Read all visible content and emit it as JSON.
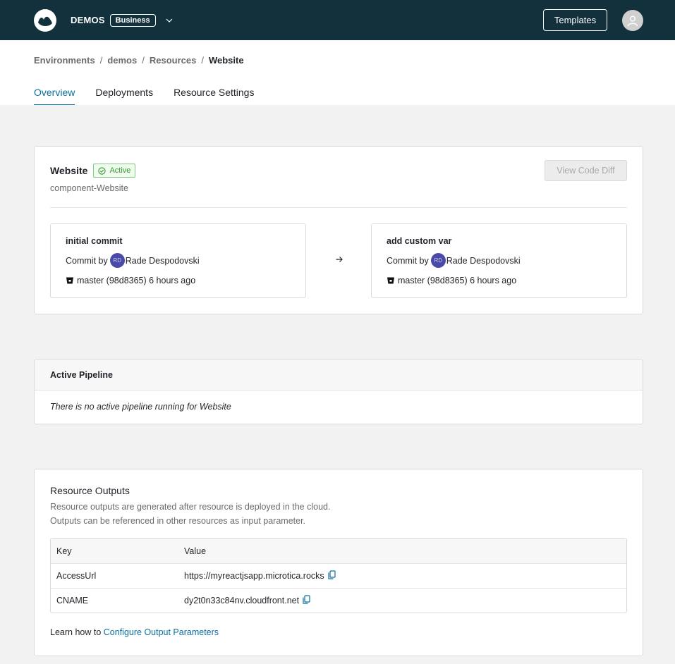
{
  "topbar": {
    "org_name": "DEMOS",
    "plan_badge": "Business",
    "templates_label": "Templates"
  },
  "breadcrumb": [
    "Environments",
    "demos",
    "Resources",
    "Website"
  ],
  "tabs": [
    "Overview",
    "Deployments",
    "Resource Settings"
  ],
  "resource": {
    "title": "Website",
    "status": "Active",
    "subtitle": "component-Website",
    "view_diff_label": "View Code Diff",
    "commits": [
      {
        "message": "initial commit",
        "by_label": "Commit by",
        "author_initials": "RD",
        "author": "Rade Despodovski",
        "branch_info": "master (98d8365) 6 hours ago"
      },
      {
        "message": "add custom var",
        "by_label": "Commit by",
        "author_initials": "RD",
        "author": "Rade Despodovski",
        "branch_info": "master (98d8365) 6 hours ago"
      }
    ]
  },
  "pipeline": {
    "title": "Active Pipeline",
    "empty_text": "There is no active pipeline running for Website"
  },
  "outputs": {
    "title": "Resource Outputs",
    "desc_line1": "Resource outputs are generated after resource is deployed in the cloud.",
    "desc_line2": "Outputs can be referenced in other resources as input parameter.",
    "headers": [
      "Key",
      "Value"
    ],
    "rows": [
      {
        "key": "AccessUrl",
        "value": "https://myreactjsapp.microtica.rocks"
      },
      {
        "key": "CNAME",
        "value": "dy2t0n33c84nv.cloudfront.net"
      }
    ],
    "learn_prefix": "Learn how to",
    "learn_link": "Configure Output Parameters"
  },
  "colors": {
    "topbar": "#13303d",
    "accent": "#0a6f9e",
    "active_green": "#2e9a2e"
  }
}
